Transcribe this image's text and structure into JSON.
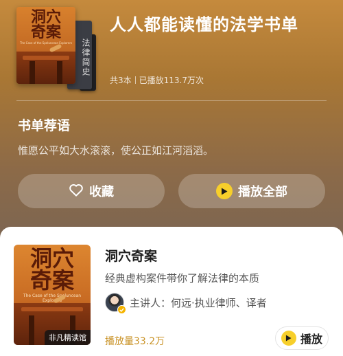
{
  "header": {
    "title": "人人都能读懂的法学书单",
    "book_count": "共3本",
    "play_stats": "已播放113.7万次",
    "cover_main_title": "洞穴\n奇案",
    "cover_spine_title": "法律简史",
    "cover_subtitle": "The Case of the Speluncean Explorers"
  },
  "recommendation": {
    "heading": "书单荐语",
    "quote": "惟愿公平如大水滚滚，使公正如江河滔滔。"
  },
  "actions": {
    "favorite_label": "收藏",
    "play_all_label": "播放全部"
  },
  "book": {
    "cover_title": "洞穴\n奇案",
    "cover_subtitle": "The Case of the Speluncean Explorers",
    "badge": "非凡精读馆",
    "name": "洞穴奇案",
    "description": "经典虚构案件带你了解法律的本质",
    "speaker": "主讲人：何远·执业律师、译者",
    "play_count": "播放量33.2万",
    "play_label": "播放"
  },
  "colors": {
    "accent_yellow": "#f7cf2b",
    "play_count": "#c99226"
  }
}
